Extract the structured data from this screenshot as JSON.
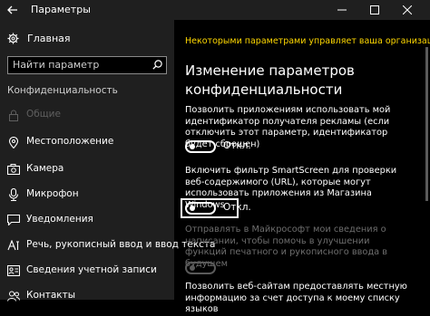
{
  "window": {
    "title": "Параметры"
  },
  "sidebar": {
    "home_label": "Главная",
    "search_placeholder": "Найти параметр",
    "section_label": "Конфиденциальность",
    "items": [
      {
        "label": "Общие",
        "icon": "lock-icon",
        "selected": true
      },
      {
        "label": "Местоположение",
        "icon": "location-icon"
      },
      {
        "label": "Камера",
        "icon": "camera-icon"
      },
      {
        "label": "Микрофон",
        "icon": "microphone-icon"
      },
      {
        "label": "Уведомления",
        "icon": "notifications-icon"
      },
      {
        "label": "Речь, рукописный ввод и ввод текста",
        "icon": "speech-icon"
      },
      {
        "label": "Сведения учетной записи",
        "icon": "account-info-icon"
      },
      {
        "label": "Контакты",
        "icon": "contacts-icon"
      }
    ]
  },
  "main": {
    "notice": "Некоторыми параметрами управляет ваша организация.",
    "heading_line1": "Изменение параметров",
    "heading_line2": "конфиденциальности",
    "settings": [
      {
        "text": "Позволить приложениям использовать мой идентификатор получателя рекламы (если отключить этот параметр, идентификатор будет сброшен)",
        "toggle": "Откл.",
        "enabled": true
      },
      {
        "text": "Включить фильтр SmartScreen для проверки веб-содержимого (URL), которые могут использовать приложения из Магазина Windows",
        "toggle": "Откл.",
        "enabled": true,
        "focused": true
      },
      {
        "text": "Отправлять в Майкрософт мои сведения о написании, чтобы помочь в улучшении функций печатного и рукописного ввода в будущем",
        "toggle": "",
        "enabled": false
      },
      {
        "text": "Позволить веб-сайтам предоставлять местную информацию за счет доступа к моему списку языков",
        "toggle": "",
        "enabled": true
      }
    ]
  }
}
